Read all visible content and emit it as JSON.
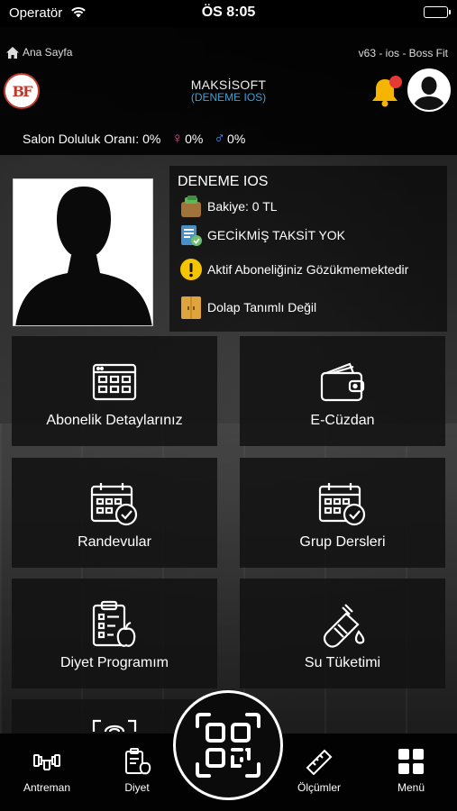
{
  "status_bar": {
    "carrier": "Operatör",
    "time": "ÖS 8:05"
  },
  "header": {
    "home_label": "Ana Sayfa",
    "version": "v63 - ios -  Boss Fit",
    "logo_text": "BF",
    "company_name": "MAKSİSOFT",
    "company_sub": "(DENEME IOS)",
    "occupancy_label": "Salon Doluluk Oranı: 0%",
    "female_value": "0%",
    "male_value": "0%",
    "colors": {
      "brand_red": "#c0392b",
      "link_blue": "#3aa3d9",
      "bell": "#f5b400",
      "notification": "#e53935"
    }
  },
  "profile": {
    "name": "DENEME IOS",
    "balance": "Bakiye: 0 TL",
    "installment": "GECİKMİŞ TAKSİT YOK",
    "subscription": "Aktif Aboneliğiniz Gözükmemektedir",
    "locker": "Dolap Tanımlı Değil"
  },
  "tiles": [
    {
      "label": "Abonelik Detaylarınız",
      "icon": "browser-window-icon"
    },
    {
      "label": "E-Cüzdan",
      "icon": "wallet-icon"
    },
    {
      "label": "Randevular",
      "icon": "calendar-check-icon"
    },
    {
      "label": "Grup Dersleri",
      "icon": "calendar-check-icon"
    },
    {
      "label": "Diyet Programım",
      "icon": "diet-clipboard-icon"
    },
    {
      "label": "Su Tüketimi",
      "icon": "water-bottle-icon"
    }
  ],
  "bottom_nav": {
    "items": [
      {
        "label": "Antreman",
        "icon": "dumbbell-icon"
      },
      {
        "label": "Diyet",
        "icon": "diet-icon"
      },
      {
        "label": "Ölçümler",
        "icon": "ruler-icon"
      },
      {
        "label": "Menü",
        "icon": "grid-icon"
      }
    ],
    "center_icon": "qr-code-icon"
  }
}
